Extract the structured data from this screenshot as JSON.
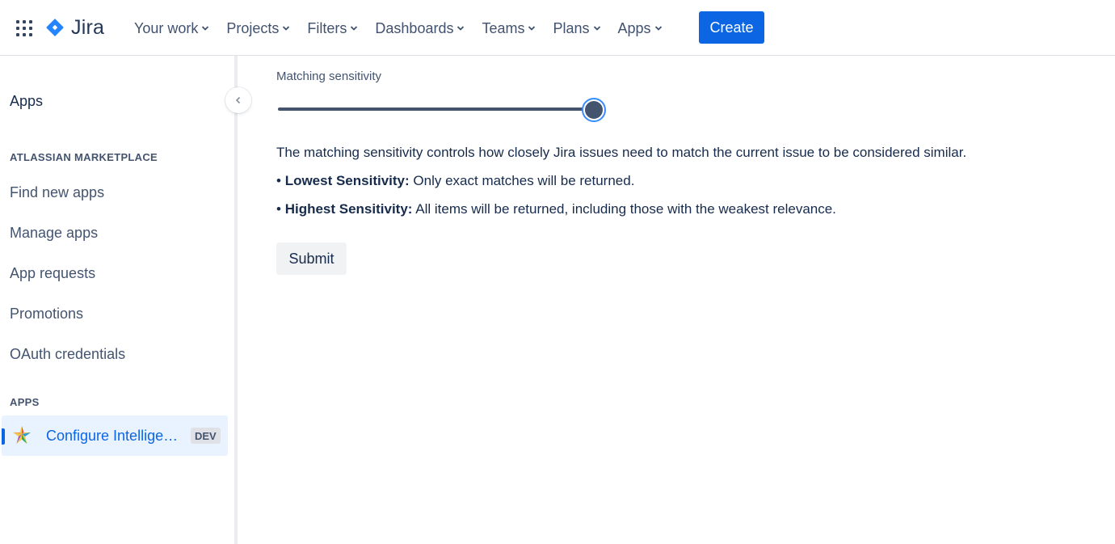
{
  "topnav": {
    "logo_text": "Jira",
    "items": [
      {
        "label": "Your work"
      },
      {
        "label": "Projects"
      },
      {
        "label": "Filters"
      },
      {
        "label": "Dashboards"
      },
      {
        "label": "Teams"
      },
      {
        "label": "Plans"
      },
      {
        "label": "Apps"
      }
    ],
    "create_label": "Create"
  },
  "sidebar": {
    "title": "Apps",
    "sections": [
      {
        "heading": "ATLASSIAN MARKETPLACE",
        "items": [
          {
            "label": "Find new apps"
          },
          {
            "label": "Manage apps"
          },
          {
            "label": "App requests"
          },
          {
            "label": "Promotions"
          },
          {
            "label": "OAuth credentials"
          }
        ]
      },
      {
        "heading": "APPS",
        "selected_app": {
          "label": "Configure Intelligent Search",
          "badge": "DEV"
        }
      }
    ]
  },
  "main": {
    "sensitivity_label": "Matching sensitivity",
    "slider_value_fraction": 1.0,
    "description": "The matching sensitivity controls how closely Jira issues need to match the current issue to be considered similar.",
    "lowest": {
      "bullet": "•",
      "term": "Lowest Sensitivity:",
      "text": "Only exact matches will be returned."
    },
    "highest": {
      "bullet": "•",
      "term": "Highest Sensitivity:",
      "text": "All items will be returned, including those with the weakest relevance."
    },
    "submit_label": "Submit"
  },
  "colors": {
    "brand_blue": "#0c66e4",
    "text_dark": "#172b4d",
    "text_subtle": "#44546f",
    "selected_bg": "#e9f2ff"
  }
}
